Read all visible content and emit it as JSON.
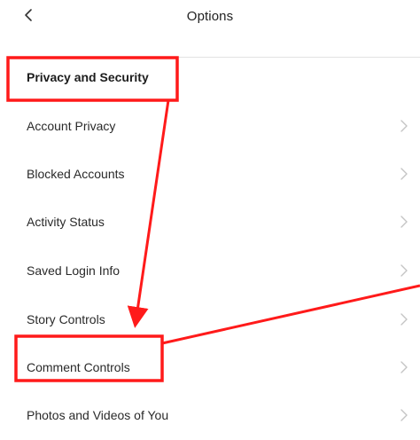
{
  "header": {
    "title": "Options",
    "back_icon": "chevron-left-icon"
  },
  "section": {
    "title": "Privacy and Security"
  },
  "items": [
    {
      "label": "Account Privacy",
      "icon": "chevron-right-icon"
    },
    {
      "label": "Blocked Accounts",
      "icon": "chevron-right-icon"
    },
    {
      "label": "Activity Status",
      "icon": "chevron-right-icon"
    },
    {
      "label": "Saved Login Info",
      "icon": "chevron-right-icon"
    },
    {
      "label": "Story Controls",
      "icon": "chevron-right-icon"
    },
    {
      "label": "Comment Controls",
      "icon": "chevron-right-icon"
    },
    {
      "label": "Photos and Videos of You",
      "icon": "chevron-right-icon"
    }
  ],
  "annotations": {
    "highlight_color": "#ff1a1a",
    "highlighted": [
      "Privacy and Security",
      "Comment Controls"
    ]
  }
}
